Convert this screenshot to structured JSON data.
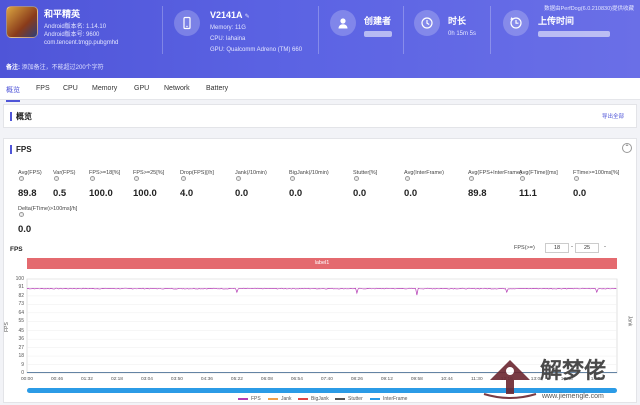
{
  "header": {
    "game_name": "和平精英",
    "android_version_line": "Android版本名: 1.14.10",
    "android_code_line": "Android版本号: 9600",
    "package": "com.tencent.tmgp.pubgmhd",
    "note_label": "备注:",
    "note_placeholder": "添加备注，不能超过200个字符",
    "device": {
      "name": "V2141A",
      "memory": "Memory: 11G",
      "cpu": "CPU: lahaina",
      "gpu": "GPU: Qualcomm Adreno (TM) 660"
    },
    "creator_label": "创建者",
    "duration_label": "时长",
    "duration_value": "0h 15m 5s",
    "upload_label": "上传时间",
    "perfdog_version": "数据由PerfDog(6.0.210830)提供收藏"
  },
  "tabs": [
    "概览",
    "FPS",
    "CPU",
    "Memory",
    "GPU",
    "Network",
    "Battery"
  ],
  "overview": {
    "title": "概览",
    "export_label": "导出全部"
  },
  "fps_panel": {
    "title": "FPS",
    "collapse_icon": "chevron-up-icon",
    "metrics": [
      {
        "label": "Avg(FPS)",
        "value": "89.8"
      },
      {
        "label": "Var(FPS)",
        "value": "0.5"
      },
      {
        "label": "FPS>=18[%]",
        "value": "100.0"
      },
      {
        "label": "FPS>=25[%]",
        "value": "100.0"
      },
      {
        "label": "Drop(FPS)[/h]",
        "value": "4.0"
      },
      {
        "label": "Jank(/10min)",
        "value": "0.0"
      },
      {
        "label": "BigJank(/10min)",
        "value": "0.0"
      },
      {
        "label": "Stutter[%]",
        "value": "0.0"
      },
      {
        "label": "Avg(InterFrame)",
        "value": "0.0"
      },
      {
        "label": "Avg(FPS+InterFrame)",
        "value": "89.8"
      },
      {
        "label": "Avg(FTime)[ms]",
        "value": "11.1"
      },
      {
        "label": "FTime>=100ms[%]",
        "value": "0.0"
      },
      {
        "label": "Delta(FTime)>100ms[/h]",
        "value": "0.0"
      }
    ]
  },
  "fps_chart_controls": {
    "title": "FPS",
    "threshold_label": "FPS(>=)",
    "threshold_low": "18",
    "threshold_high": "25",
    "dash": "-",
    "close": "×"
  },
  "chart_data": {
    "type": "line",
    "label_bar": "label1",
    "ylabel": "FPS",
    "y2label": "Jank",
    "ylim": [
      0,
      100
    ],
    "yticks": [
      "100",
      "91",
      "82",
      "73",
      "64",
      "55",
      "45",
      "36",
      "27",
      "18",
      "9",
      "0"
    ],
    "xticks": [
      "00:00",
      "00:46",
      "01:32",
      "02:18",
      "03:04",
      "03:50",
      "04:36",
      "05:22",
      "06:08",
      "06:54",
      "07:40",
      "08:26",
      "09:12",
      "09:58",
      "10:44",
      "11:30",
      "12:16",
      "13:02",
      "13:48",
      "14:34"
    ],
    "series": [
      {
        "name": "FPS",
        "color": "#b43bb4",
        "baseline": 89.8
      },
      {
        "name": "Jank",
        "color": "#f0a04b",
        "baseline": 0
      },
      {
        "name": "BigJank",
        "color": "#e04545",
        "baseline": 0
      },
      {
        "name": "Stutter",
        "color": "#555555",
        "baseline": 0
      },
      {
        "name": "InterFrame",
        "color": "#2b9be6",
        "baseline": 0
      }
    ],
    "dips": [
      {
        "x": "05:22",
        "y": 86
      },
      {
        "x": "08:26",
        "y": 85
      },
      {
        "x": "09:58",
        "y": 83
      },
      {
        "x": "12:16",
        "y": 86
      },
      {
        "x": "14:34",
        "y": 86
      }
    ]
  },
  "watermark": {
    "text": "解梦佬",
    "url": "www.jiemengle.com"
  },
  "colors": {
    "accent": "#4f55d8",
    "label_bar": "#e46a6f",
    "scroll": "#2b9be6"
  }
}
